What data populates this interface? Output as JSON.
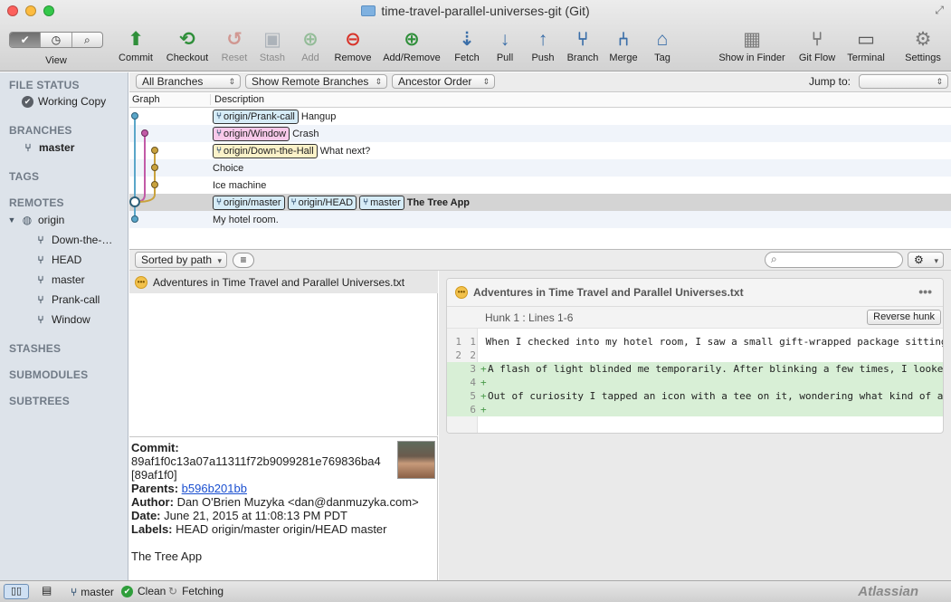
{
  "window": {
    "title": "time-travel-parallel-universes-git (Git)"
  },
  "toolbar": {
    "view_label": "View",
    "buttons": [
      {
        "label": "Commit",
        "icon": "commit-icon",
        "enabled": true
      },
      {
        "label": "Checkout",
        "icon": "checkout-icon",
        "enabled": true
      },
      {
        "label": "Reset",
        "icon": "reset-icon",
        "enabled": false
      },
      {
        "label": "Stash",
        "icon": "stash-icon",
        "enabled": false
      },
      {
        "label": "Add",
        "icon": "add-icon",
        "enabled": false
      },
      {
        "label": "Remove",
        "icon": "remove-icon",
        "enabled": true
      },
      {
        "label": "Add/Remove",
        "icon": "add-remove-icon",
        "enabled": true
      },
      {
        "label": "Fetch",
        "icon": "fetch-icon",
        "enabled": true
      },
      {
        "label": "Pull",
        "icon": "pull-icon",
        "enabled": true
      },
      {
        "label": "Push",
        "icon": "push-icon",
        "enabled": true
      },
      {
        "label": "Branch",
        "icon": "branch-icon",
        "enabled": true
      },
      {
        "label": "Merge",
        "icon": "merge-icon",
        "enabled": true
      },
      {
        "label": "Tag",
        "icon": "tag-icon",
        "enabled": true
      }
    ],
    "right_buttons": [
      {
        "label": "Show in Finder",
        "icon": "finder-icon"
      },
      {
        "label": "Git Flow",
        "icon": "git-flow-icon"
      },
      {
        "label": "Terminal",
        "icon": "terminal-icon"
      },
      {
        "label": "Settings",
        "icon": "gear-icon"
      }
    ]
  },
  "sidebar": {
    "file_status_header": "FILE STATUS",
    "working_copy": "Working Copy",
    "branches_header": "BRANCHES",
    "current_branch": "master",
    "tags_header": "TAGS",
    "remotes_header": "REMOTES",
    "remote_name": "origin",
    "remote_branches": [
      "Down-the-…",
      "HEAD",
      "master",
      "Prank-call",
      "Window"
    ],
    "stashes_header": "STASHES",
    "submodules_header": "SUBMODULES",
    "subtrees_header": "SUBTREES"
  },
  "filter": {
    "branches": "All Branches",
    "remote": "Show Remote Branches",
    "order": "Ancestor Order",
    "jump_label": "Jump to:",
    "jump_value": ""
  },
  "log": {
    "col_graph": "Graph",
    "col_description": "Description",
    "rows": [
      {
        "tags": [
          {
            "label": "origin/Prank-call",
            "kind": "remote"
          }
        ],
        "message": "Hangup"
      },
      {
        "tags": [
          {
            "label": "origin/Window",
            "kind": "pink"
          }
        ],
        "message": "Crash"
      },
      {
        "tags": [
          {
            "label": "origin/Down-the-Hall",
            "kind": "yellow"
          }
        ],
        "message": "What next?"
      },
      {
        "tags": [],
        "message": "Choice"
      },
      {
        "tags": [],
        "message": "Ice machine"
      },
      {
        "tags": [
          {
            "label": "origin/master",
            "kind": "remote"
          },
          {
            "label": "origin/HEAD",
            "kind": "remote"
          },
          {
            "label": "master",
            "kind": "remote"
          }
        ],
        "message": "The Tree App",
        "selected": true
      },
      {
        "tags": [],
        "message": "My hotel room."
      }
    ]
  },
  "files": {
    "sort_label": "Sorted by path",
    "search_placeholder": "",
    "items": [
      {
        "name": "Adventures in Time Travel and Parallel Universes.txt",
        "status_icon": "modified-icon"
      }
    ]
  },
  "commit": {
    "commit_label": "Commit:",
    "hash": "89af1f0c13a07a11311f72b9099281e769836ba4",
    "short_hash": "[89af1f0]",
    "parents_label": "Parents:",
    "parents": "b596b201bb",
    "author_label": "Author:",
    "author": "Dan O'Brien Muzyka <dan@danmuzyka.com>",
    "date_label": "Date:",
    "date": "June 21, 2015 at 11:08:13 PM PDT",
    "labels_label": "Labels:",
    "labels": "HEAD origin/master origin/HEAD master",
    "message": "The Tree App"
  },
  "diff": {
    "file": "Adventures in Time Travel and Parallel Universes.txt",
    "hunk_title": "Hunk 1 : Lines 1-6",
    "reverse_label": "Reverse hunk",
    "lines": [
      {
        "old": "1",
        "new": "1",
        "type": "ctx",
        "text": " When I checked into my hotel room, I saw a small gift-wrapped package sitting squar"
      },
      {
        "old": "2",
        "new": "2",
        "type": "ctx",
        "text": ""
      },
      {
        "old": "",
        "new": "3",
        "type": "add",
        "text": "A flash of light blinded me temporarily. After blinking a few times, I looked down"
      },
      {
        "old": "",
        "new": "4",
        "type": "add",
        "text": ""
      },
      {
        "old": "",
        "new": "5",
        "type": "add",
        "text": "Out of curiosity I tapped an icon with a tee on it, wondering what kind of app woul"
      },
      {
        "old": "",
        "new": "6",
        "type": "add",
        "text": ""
      }
    ]
  },
  "status": {
    "branch": "master",
    "clean": "Clean",
    "fetching": "Fetching",
    "brand": "Atlassian"
  },
  "colors": {
    "remote_tag": "#d6ecf7",
    "pink_tag": "#f8c9ea",
    "yellow_tag": "#fbf2c9",
    "lane1": "#5aa6c9",
    "lane2": "#c25aa7",
    "lane3": "#c9a23d"
  }
}
